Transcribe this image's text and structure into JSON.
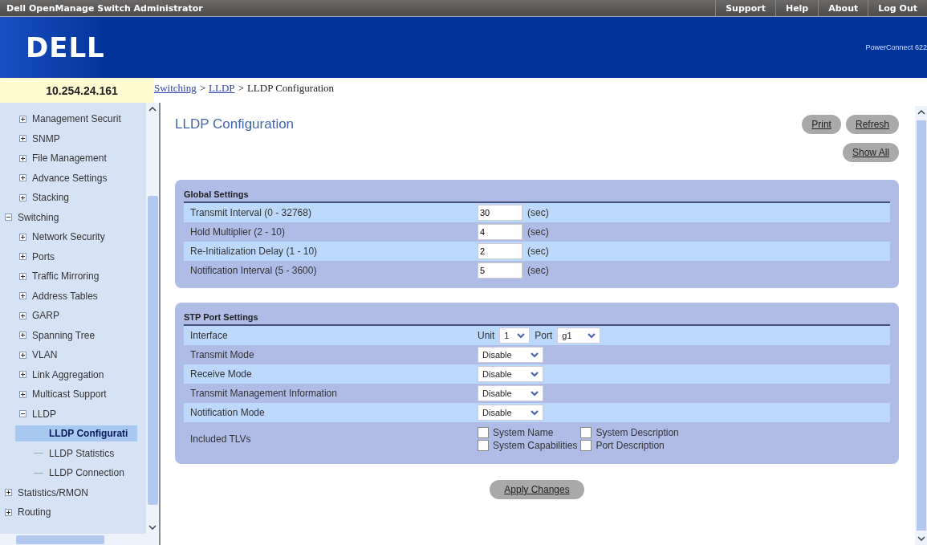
{
  "top_bar": {
    "title": "Dell OpenManage Switch Administrator",
    "links": [
      "Support",
      "Help",
      "About",
      "Log Out"
    ]
  },
  "header": {
    "logo": "DELL",
    "product": "PowerConnect 622"
  },
  "address": "10.254.24.161",
  "breadcrumb": [
    {
      "kind": "link",
      "label": "Switching"
    },
    {
      "kind": "separator",
      "label": ">"
    },
    {
      "kind": "link",
      "label": "LLDP"
    },
    {
      "kind": "separator",
      "label": ">"
    },
    {
      "kind": "current",
      "label": "LLDP Configuration"
    }
  ],
  "sidebar": {
    "items": [
      {
        "label": "Management Securit",
        "expanded": false,
        "selected": false
      },
      {
        "label": "SNMP",
        "expanded": false,
        "selected": false
      },
      {
        "label": "File Management",
        "expanded": false,
        "selected": false
      },
      {
        "label": "Advance Settings",
        "expanded": false,
        "selected": false
      },
      {
        "label": "Stacking",
        "expanded": false,
        "selected": false
      }
    ]
  },
  "tree": [
    {
      "label": "Switching",
      "expanded": true,
      "selected": false,
      "children": [
        {
          "label": "Network Security",
          "expanded": false,
          "selected": false
        },
        {
          "label": "Ports",
          "expanded": false,
          "selected": false
        },
        {
          "label": "Traffic Mirroring",
          "expanded": false,
          "selected": false
        },
        {
          "label": "Address Tables",
          "expanded": false,
          "selected": false
        },
        {
          "label": "GARP",
          "expanded": false,
          "selected": false
        },
        {
          "label": "Spanning Tree",
          "expanded": false,
          "selected": false
        },
        {
          "label": "VLAN",
          "expanded": false,
          "selected": false
        },
        {
          "label": "Link Aggregation",
          "expanded": false,
          "selected": false
        },
        {
          "label": "Multicast Support",
          "expanded": false,
          "selected": false
        },
        {
          "label": "LLDP",
          "expanded": true,
          "selected": false,
          "children": [
            {
              "label": "LLDP Configurati",
              "selected": true
            },
            {
              "label": "LLDP Statistics",
              "selected": false
            },
            {
              "label": "LLDP Connection",
              "selected": false
            }
          ]
        }
      ]
    },
    {
      "label": "Statistics/RMON",
      "expanded": false,
      "selected": false
    },
    {
      "label": "Routing",
      "expanded": false,
      "selected": false
    }
  ],
  "page_title": "LLDP Configuration",
  "buttons": [
    "Print",
    "Refresh"
  ],
  "show_all": "Show All",
  "global_settings": {
    "title": "Global Settings",
    "rows": [
      {
        "label": "Transmit Interval (0 - 32768)",
        "value": "30",
        "unit": "(sec)"
      },
      {
        "label": "Hold Multiplier (2 - 10)",
        "value": "4",
        "unit": "(sec)"
      },
      {
        "label": "Re-Initialization Delay (1 - 10)",
        "value": "2",
        "unit": "(sec)"
      },
      {
        "label": "Notification Interval (5 - 3600)",
        "value": "5",
        "unit": "(sec)"
      }
    ]
  },
  "port_settings": {
    "title": "STP Port Settings",
    "rows": [
      {
        "kind": "interface",
        "label": "Interface",
        "unit_label": "Unit",
        "unit_value": "1",
        "port_label": "Port",
        "port_value": "g1"
      },
      {
        "kind": "select",
        "label": "Transmit Mode",
        "value": "Disable"
      },
      {
        "kind": "select",
        "label": "Receive Mode",
        "value": "Disable"
      },
      {
        "kind": "select",
        "label": "Transmit Management Information",
        "value": "Disable"
      },
      {
        "kind": "select",
        "label": "Notification Mode",
        "value": "Disable"
      },
      {
        "kind": "checkboxes",
        "label": "Included TLVs",
        "options": [
          {
            "label": "System Name",
            "checked": false
          },
          {
            "label": "System Description",
            "checked": false
          },
          {
            "label": "System Capabilities",
            "checked": false
          },
          {
            "label": "Port Description",
            "checked": false
          }
        ]
      }
    ]
  },
  "apply": "Apply Changes"
}
